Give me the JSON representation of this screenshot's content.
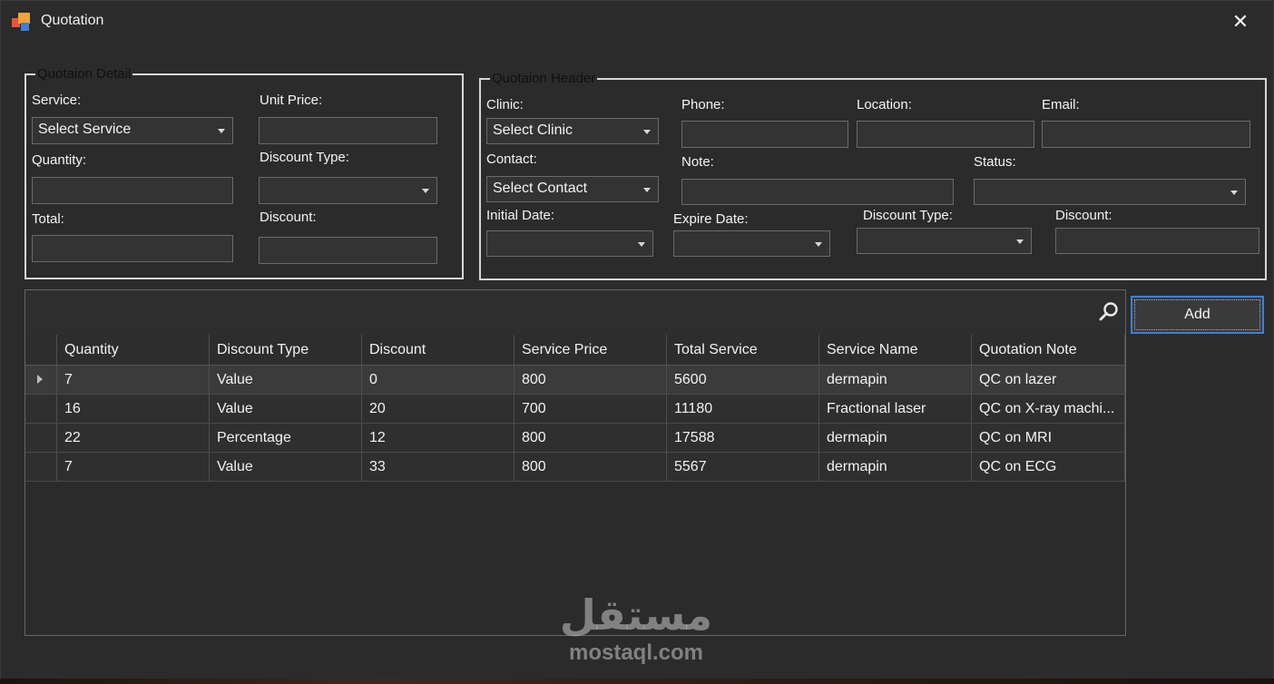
{
  "window": {
    "title": "Quotation",
    "close_glyph": "✕"
  },
  "detail_group": {
    "legend": "Quotaion Detail",
    "service_label": "Service:",
    "service_value": "Select Service",
    "unit_price_label": "Unit Price:",
    "quantity_label": "Quantity:",
    "discount_type_label": "Discount Type:",
    "total_label": "Total:",
    "discount_label": "Discount:"
  },
  "header_group": {
    "legend": "Quotaion Header",
    "clinic_label": "Clinic:",
    "clinic_value": "Select Clinic",
    "phone_label": "Phone:",
    "location_label": "Location:",
    "email_label": "Email:",
    "contact_label": "Contact:",
    "contact_value": "Select Contact",
    "note_label": "Note:",
    "status_label": "Status:",
    "initial_date_label": "Initial Date:",
    "expire_date_label": "Expire Date:",
    "discount_type_label": "Discount Type:",
    "discount_label": "Discount:"
  },
  "grid": {
    "columns": [
      "Quantity",
      "Discount Type",
      "Discount",
      "Service Price",
      "Total Service",
      "Service Name",
      "Quotation Note"
    ],
    "rows": [
      [
        "7",
        "Value",
        "0",
        "800",
        "5600",
        "dermapin",
        "QC on lazer"
      ],
      [
        "16",
        "Value",
        "20",
        "700",
        "11180",
        "Fractional laser",
        "QC on X-ray machi..."
      ],
      [
        "22",
        "Percentage",
        "12",
        "800",
        "17588",
        "dermapin",
        "QC on MRI"
      ],
      [
        "7",
        "Value",
        "33",
        "800",
        "5567",
        "dermapin",
        "QC on ECG"
      ]
    ]
  },
  "add_button_label": "Add",
  "watermark": {
    "arabic": "مستقل",
    "latin": "mostaql.com"
  },
  "icons": {
    "app": "app-icon",
    "search": "search-icon",
    "close": "close-icon"
  },
  "colors": {
    "background": "#2b2b2b",
    "focus_border": "#3f7fd1",
    "group_border": "#d6d6d6"
  }
}
